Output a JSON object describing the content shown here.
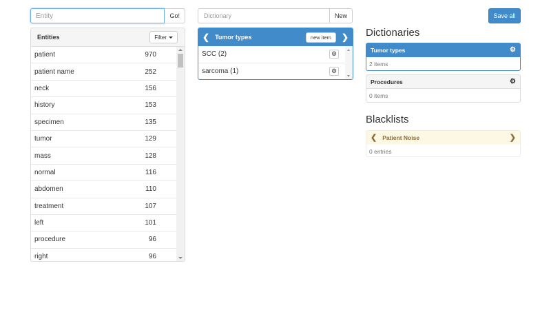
{
  "entity_search": {
    "placeholder": "Entity",
    "go_label": "Go!"
  },
  "entities": {
    "title": "Entities",
    "filter_label": "Filter",
    "rows": [
      {
        "name": "patient",
        "count": "970"
      },
      {
        "name": "patient name",
        "count": "252"
      },
      {
        "name": "neck",
        "count": "156"
      },
      {
        "name": "history",
        "count": "153"
      },
      {
        "name": "specimen",
        "count": "135"
      },
      {
        "name": "tumor",
        "count": "129"
      },
      {
        "name": "mass",
        "count": "128"
      },
      {
        "name": "normal",
        "count": "116"
      },
      {
        "name": "abdomen",
        "count": "110"
      },
      {
        "name": "treatment",
        "count": "107"
      },
      {
        "name": "left",
        "count": "101"
      },
      {
        "name": "procedure",
        "count": "96"
      },
      {
        "name": "right",
        "count": "96"
      }
    ]
  },
  "dictionary_search": {
    "placeholder": "Dictionary",
    "new_label": "New"
  },
  "active_dictionary": {
    "title": "Tumor types",
    "new_item_label": "new item",
    "items": [
      {
        "label": "SCC (2)"
      },
      {
        "label": "sarcoma (1)"
      }
    ]
  },
  "save_all_label": "Save all",
  "dictionaries": {
    "title": "Dictionaries",
    "cards": [
      {
        "name": "Tumor types",
        "count_text": "2 items",
        "active": true
      },
      {
        "name": "Procedures",
        "count_text": "0 items",
        "active": false
      }
    ]
  },
  "blacklists": {
    "title": "Blacklists",
    "cards": [
      {
        "name": "Patient Noise",
        "count_text": "0 entries"
      }
    ]
  },
  "icons": {
    "chevron_left": "chevron-left-icon",
    "chevron_right": "chevron-right-icon",
    "cog": "cog-icon",
    "caret_down": "caret-down-icon"
  },
  "colors": {
    "primary": "#428bca",
    "warning_bg": "#fcf8e3",
    "warning_text": "#8a6d3b"
  }
}
